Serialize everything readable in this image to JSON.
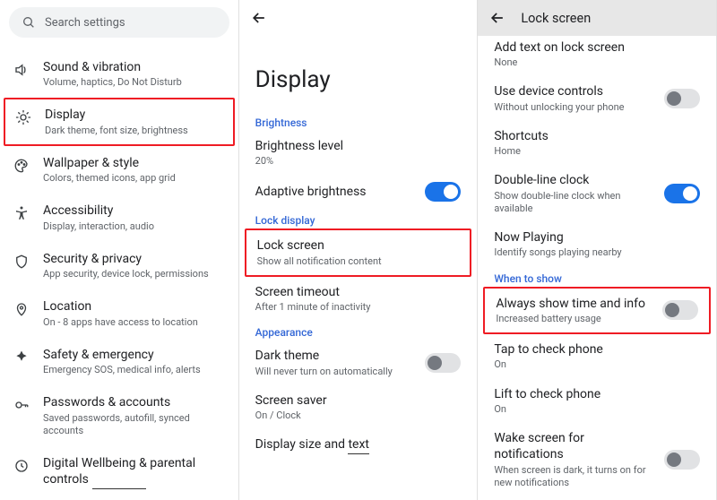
{
  "panel1": {
    "search_placeholder": "Search settings",
    "items": [
      {
        "title": "Sound & vibration",
        "sub": "Volume, haptics, Do Not Disturb",
        "icon": "volume"
      },
      {
        "title": "Display",
        "sub": "Dark theme, font size, brightness",
        "icon": "display",
        "hl": true
      },
      {
        "title": "Wallpaper & style",
        "sub": "Colors, themed icons, app grid",
        "icon": "palette"
      },
      {
        "title": "Accessibility",
        "sub": "Display, interaction, audio",
        "icon": "accessibility"
      },
      {
        "title": "Security & privacy",
        "sub": "App security, device lock, permissions",
        "icon": "shield"
      },
      {
        "title": "Location",
        "sub": "On - 8 apps have access to location",
        "icon": "location"
      },
      {
        "title": "Safety & emergency",
        "sub": "Emergency SOS, medical info, alerts",
        "icon": "emergency"
      },
      {
        "title": "Passwords & accounts",
        "sub": "Saved passwords, autofill, synced accounts",
        "icon": "key"
      },
      {
        "title": "Digital Wellbeing & parental controls",
        "sub": "",
        "icon": "wellbeing"
      }
    ]
  },
  "panel2": {
    "big_title": "Display",
    "sec_brightness": "Brightness",
    "brightness_level": {
      "title": "Brightness level",
      "sub": "20%"
    },
    "adaptive": {
      "title": "Adaptive brightness",
      "on": true
    },
    "sec_lock": "Lock display",
    "lock_screen": {
      "title": "Lock screen",
      "sub": "Show all notification content",
      "hl": true
    },
    "screen_timeout": {
      "title": "Screen timeout",
      "sub": "After 1 minute of inactivity"
    },
    "sec_appearance": "Appearance",
    "dark_theme": {
      "title": "Dark theme",
      "sub": "Will never turn on automatically",
      "on": false
    },
    "screen_saver": {
      "title": "Screen saver",
      "sub": "On / Clock"
    },
    "display_size": {
      "title_a": "Display size and ",
      "title_b": "text"
    }
  },
  "panel3": {
    "header": "Lock screen",
    "add_text": {
      "title": "Add text on lock screen",
      "sub": "None"
    },
    "device_controls": {
      "title": "Use device controls",
      "sub": "Without unlocking your phone",
      "on": false
    },
    "shortcuts": {
      "title": "Shortcuts",
      "sub": "Home"
    },
    "double_line": {
      "title": "Double-line clock",
      "sub": "Show double-line clock when available",
      "on": true
    },
    "now_playing": {
      "title": "Now Playing",
      "sub": "Identify songs playing nearby"
    },
    "sec_when": "When to show",
    "always": {
      "title": "Always show time and info",
      "sub": "Increased battery usage",
      "on": false,
      "hl": true
    },
    "tap": {
      "title": "Tap to check phone",
      "sub": "On"
    },
    "lift": {
      "title": "Lift to check phone",
      "sub": "On"
    },
    "wake": {
      "title": "Wake screen for notifications",
      "sub": "When screen is dark, it turns on for new notifications",
      "on": false
    }
  }
}
